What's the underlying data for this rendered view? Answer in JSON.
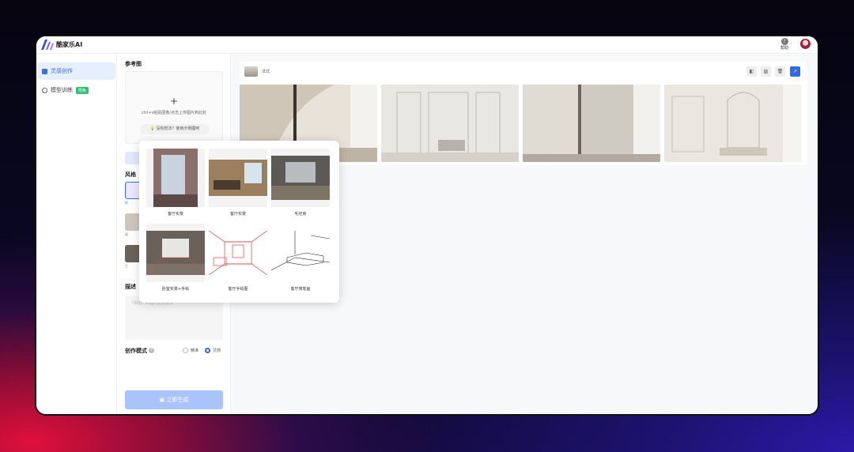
{
  "app": {
    "title": "酷家乐AI"
  },
  "header": {
    "help_label": "帮助",
    "help_icon": "?"
  },
  "nav": {
    "items": [
      {
        "label": "灵感创作",
        "active": true
      },
      {
        "label": "模型训练",
        "badge": "限免"
      }
    ]
  },
  "panel": {
    "reference_title": "参考图",
    "upload_plus": "+",
    "upload_hint": "ctrl+v粘贴图像/点击上传图片到此处",
    "example_button": "没有想法？使用示例图吧",
    "style_title": "风格",
    "style_caps": [
      "奶",
      "现",
      "工"
    ],
    "description_title": "描述",
    "description_placeholder": "「例如」中国风建筑装饰",
    "mode_title": "创作模式",
    "mode_help_icon": "?",
    "mode_options": [
      {
        "label": "精准",
        "selected": false
      },
      {
        "label": "灵感",
        "selected": true
      }
    ],
    "generate_button": "立即生成"
  },
  "main": {
    "card_label": "法式",
    "tools": [
      "compare-icon",
      "image-icon",
      "trash-icon",
      "share-icon"
    ]
  },
  "popup": {
    "items": [
      {
        "label": "客厅实景"
      },
      {
        "label": "客厅实景"
      },
      {
        "label": "毛坯房"
      },
      {
        "label": "卧室实景+手绘"
      },
      {
        "label": "客厅手绘图"
      },
      {
        "label": "客厅简笔画"
      }
    ]
  },
  "colors": {
    "accent": "#2f6be8",
    "nav_active_bg": "#e6efff",
    "badge": "#2fbf71",
    "generate_disabled": "#a9c4fb"
  }
}
